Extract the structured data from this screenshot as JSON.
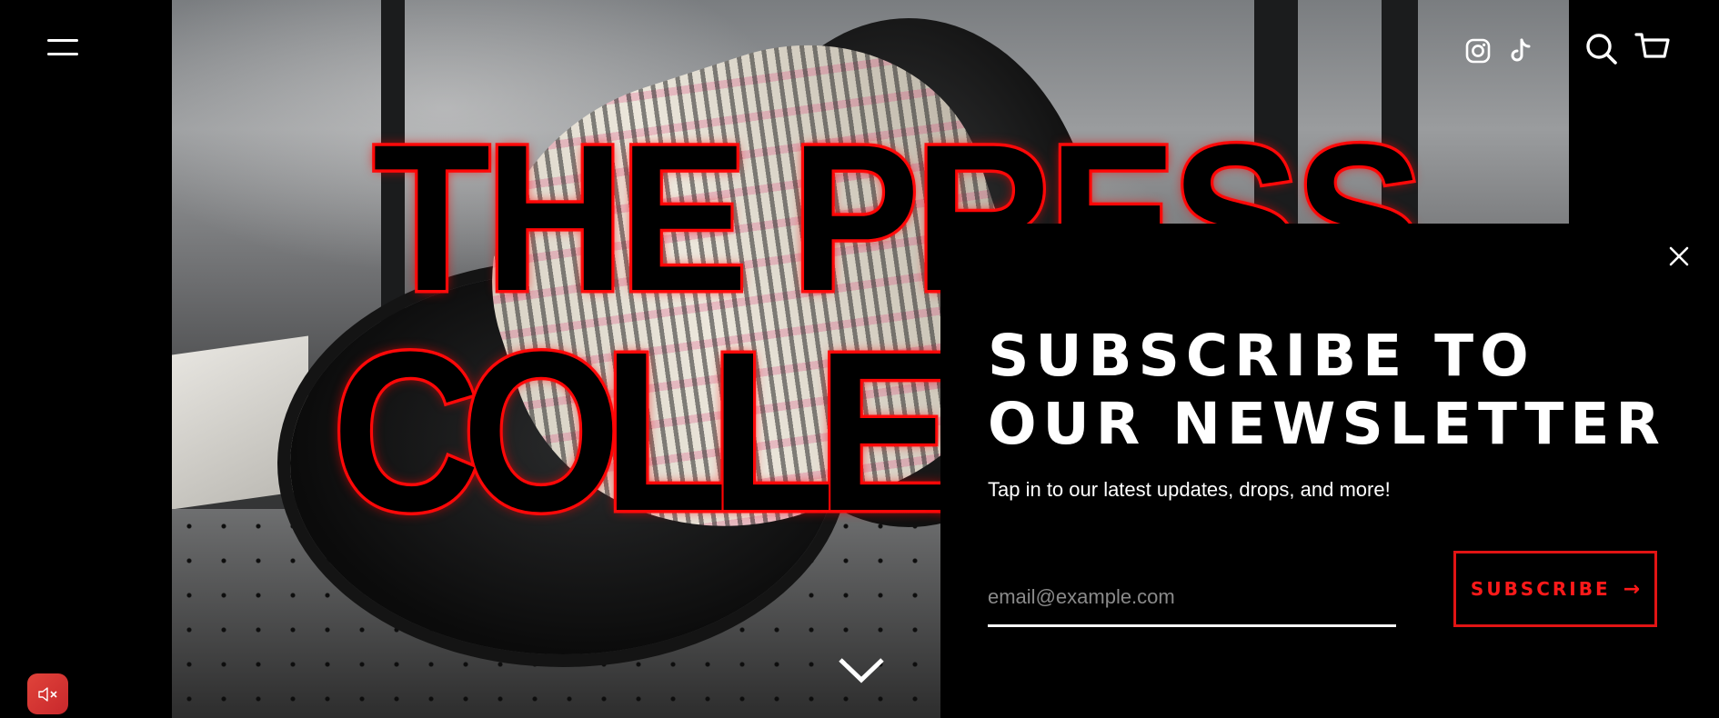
{
  "hero": {
    "logo_line1": "THE PRESS",
    "logo_line2": "COLLEX"
  },
  "header": {
    "menu_icon": "hamburger-menu-icon",
    "social_icons": [
      "instagram-icon",
      "tiktok-icon"
    ],
    "search_icon": "search-icon",
    "cart_icon": "cart-icon"
  },
  "newsletter": {
    "title_line1": "SUBSCRIBE TO",
    "title_line2": "OUR NEWSLETTER",
    "subtitle": "Tap in to our latest updates, drops, and more!",
    "email_placeholder": "email@example.com",
    "email_value": "",
    "subscribe_label": "SUBSCRIBE",
    "subscribe_arrow": "→",
    "close_icon": "close-icon"
  },
  "scroll_indicator_icon": "chevron-down-icon",
  "sound_toggle_icon": "speaker-muted-icon",
  "colors": {
    "accent_red": "#e11414",
    "modal_bg": "#000000",
    "text": "#ffffff"
  }
}
